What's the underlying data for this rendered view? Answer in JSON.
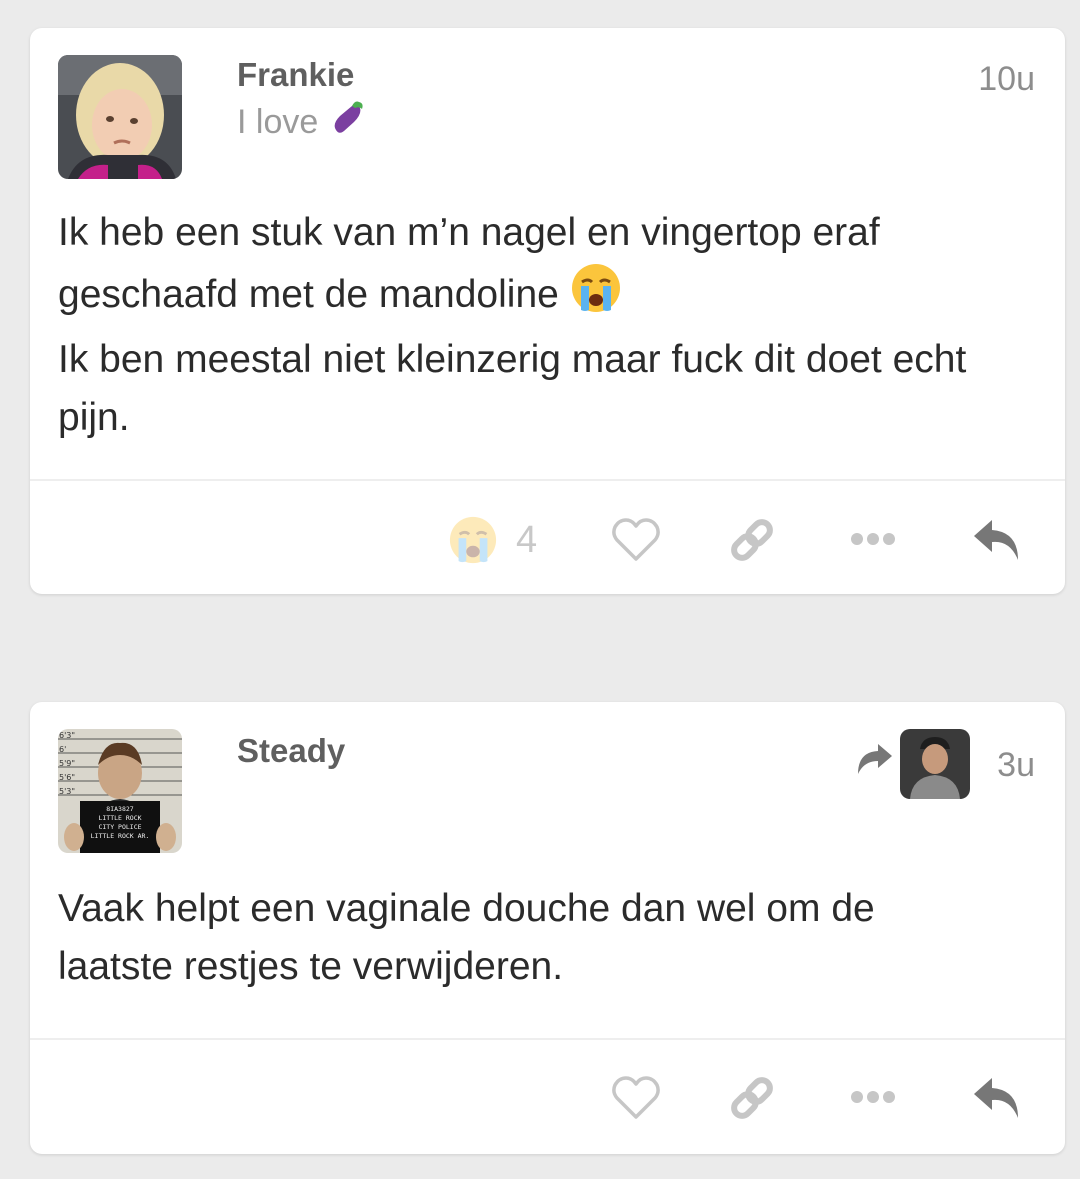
{
  "posts": [
    {
      "username": "Frankie",
      "status_text": "I love",
      "status_emoji": "eggplant-emoji",
      "time": "10u",
      "body_lines": [
        "Ik heb een stuk van m’n nagel en vingertop eraf",
        "geschaafd met de mandoline",
        "Ik ben meestal niet kleinzerig maar fuck dit doet echt",
        "pijn."
      ],
      "inline_emoji": "crying-face-emoji",
      "reaction": {
        "emoji": "crying-face-emoji",
        "count": "4"
      },
      "actions": [
        "heart-icon",
        "link-icon",
        "more-icon",
        "reply-icon"
      ]
    },
    {
      "username": "Steady",
      "time": "3u",
      "reposted": true,
      "body_lines": [
        "Vaak helpt een vaginale douche dan wel om de",
        "laatste restjes te verwijderen."
      ],
      "actions": [
        "heart-icon",
        "link-icon",
        "more-icon",
        "reply-icon"
      ]
    }
  ],
  "colors": {
    "background": "#ebebeb",
    "card": "#ffffff",
    "username": "#5f5f5f",
    "body": "#2b2b2b",
    "muted": "#9a9a9a",
    "icon": "#c6c6c6",
    "reply_icon": "#777777"
  },
  "mugshot_board": {
    "heights": [
      "6'3\"",
      "6'",
      "5'9\"",
      "5'6\"",
      "5'3\""
    ],
    "lines": [
      "8IA3827",
      "LITTLE ROCK",
      "CITY POLICE",
      "LITTLE ROCK AR."
    ]
  }
}
